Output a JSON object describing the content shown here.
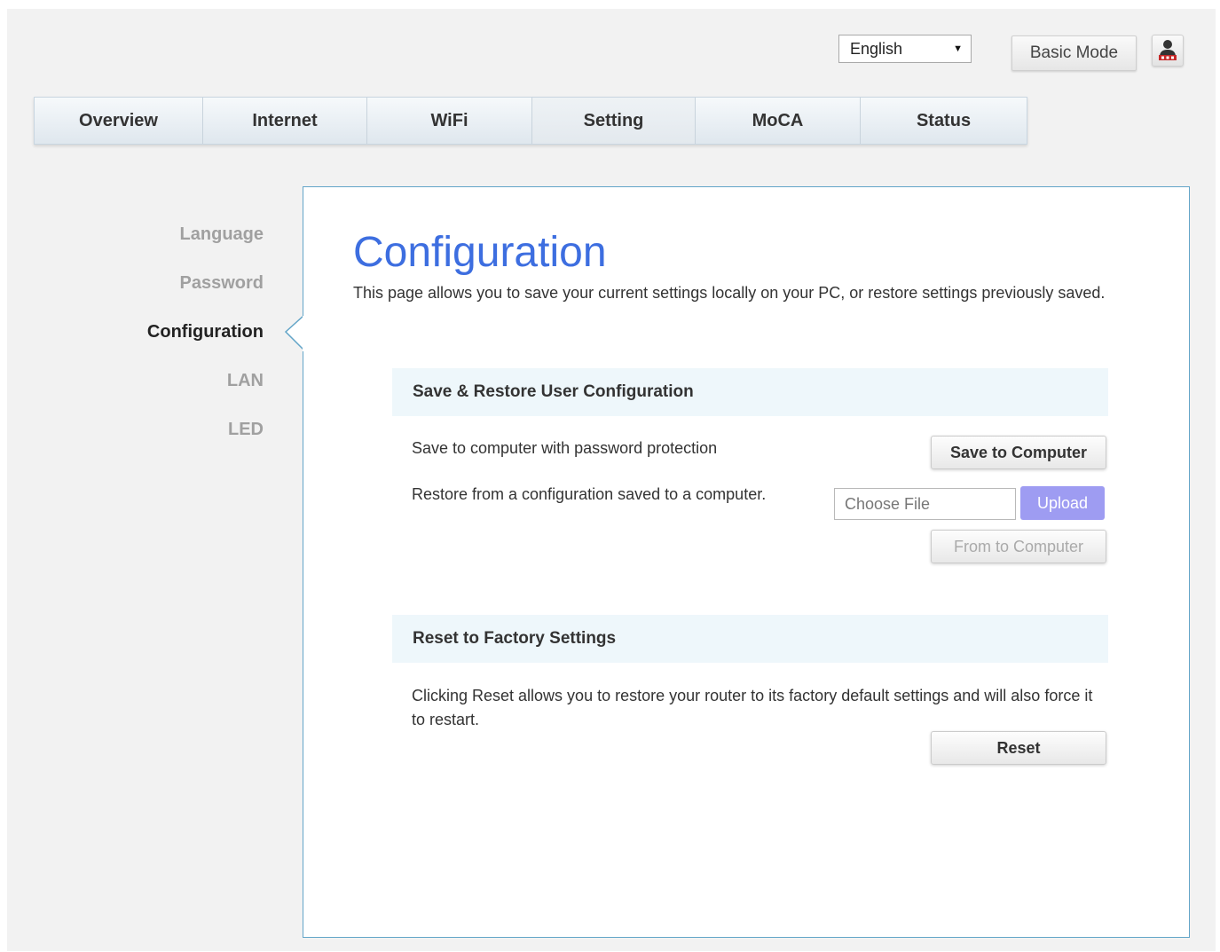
{
  "header": {
    "language": {
      "selected": "English"
    },
    "basic_mode_label": "Basic Mode",
    "user_icon": "user-icon"
  },
  "nav": {
    "tabs": [
      {
        "label": "Overview",
        "active": false
      },
      {
        "label": "Internet",
        "active": false
      },
      {
        "label": "WiFi",
        "active": false
      },
      {
        "label": "Setting",
        "active": true
      },
      {
        "label": "MoCA",
        "active": false
      },
      {
        "label": "Status",
        "active": false
      }
    ]
  },
  "sidebar": {
    "items": [
      {
        "label": "Language",
        "active": false
      },
      {
        "label": "Password",
        "active": false
      },
      {
        "label": "Configuration",
        "active": true
      },
      {
        "label": "LAN",
        "active": false
      },
      {
        "label": "LED",
        "active": false
      }
    ]
  },
  "main": {
    "title": "Configuration",
    "description": "This page allows you to save your current settings locally on your PC, or restore settings previously saved.",
    "save_restore": {
      "heading": "Save & Restore User Configuration",
      "save_text": "Save to computer with password protection",
      "save_button": "Save to Computer",
      "restore_text": "Restore from a configuration saved to a computer.",
      "file_placeholder": "Choose File",
      "upload_button": "Upload",
      "from_computer_button": "From to Computer"
    },
    "factory": {
      "heading": "Reset to Factory Settings",
      "text": "Clicking Reset allows you to restore your router to its factory default settings and will also force it to restart.",
      "reset_button": "Reset"
    }
  },
  "colors": {
    "title": "#3d6ee0",
    "panel_border": "#63a5c8",
    "section_bg": "#eef7fb",
    "upload_bg": "#9e9cf2"
  }
}
